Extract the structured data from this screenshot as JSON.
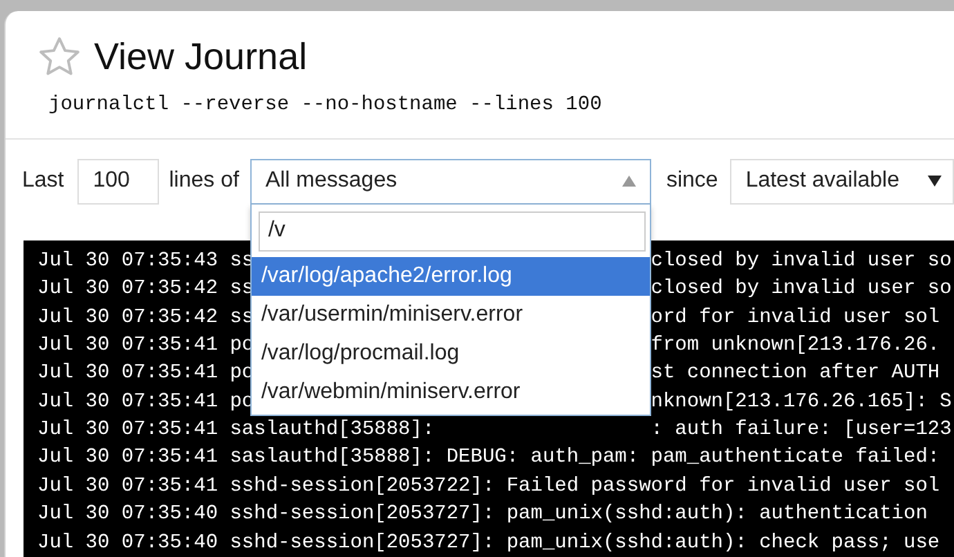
{
  "title": "View Journal",
  "starred": false,
  "command": "journalctl --reverse --no-hostname --lines 100",
  "controls": {
    "last_label": "Last",
    "lines_value": "100",
    "lines_of_label": "lines of",
    "source_select": {
      "value": "All messages",
      "expanded": true
    },
    "since_label": "since",
    "since_select": {
      "value": "Latest available",
      "expanded": false
    }
  },
  "dropdown": {
    "search_value": "/v",
    "options": [
      {
        "label": "/var/log/apache2/error.log",
        "selected": true
      },
      {
        "label": "/var/usermin/miniserv.error",
        "selected": false
      },
      {
        "label": "/var/log/procmail.log",
        "selected": false
      },
      {
        "label": "/var/webmin/miniserv.error",
        "selected": false
      }
    ]
  },
  "log_lines": [
    {
      "left": "Jul 30 07:35:43 ss",
      "right": "closed by invalid user so"
    },
    {
      "left": "Jul 30 07:35:42 ss",
      "right": "closed by invalid user so"
    },
    {
      "left": "Jul 30 07:35:42 ss",
      "right": "ord for invalid user sol"
    },
    {
      "left": "Jul 30 07:35:41 po",
      "right": "from unknown[213.176.26."
    },
    {
      "left": "Jul 30 07:35:41 po",
      "right": "st connection after AUTH"
    },
    {
      "left": "Jul 30 07:35:41 po",
      "right": "nknown[213.176.26.165]: S"
    },
    {
      "left": "Jul 30 07:35:41 saslauthd[35888]:",
      "right": ": auth failure: [user=123"
    },
    {
      "left": "Jul 30 07:35:41 saslauthd[35888]: DEBUG: auth_pam: pam_authenticate failed:"
    },
    {
      "left": "Jul 30 07:35:41 sshd-session[2053722]: Failed password for invalid user sol"
    },
    {
      "left": "Jul 30 07:35:40 sshd-session[2053727]: pam_unix(sshd:auth): authentication"
    },
    {
      "left": "Jul 30 07:35:40 sshd-session[2053727]: pam_unix(sshd:auth): check pass; use"
    }
  ]
}
